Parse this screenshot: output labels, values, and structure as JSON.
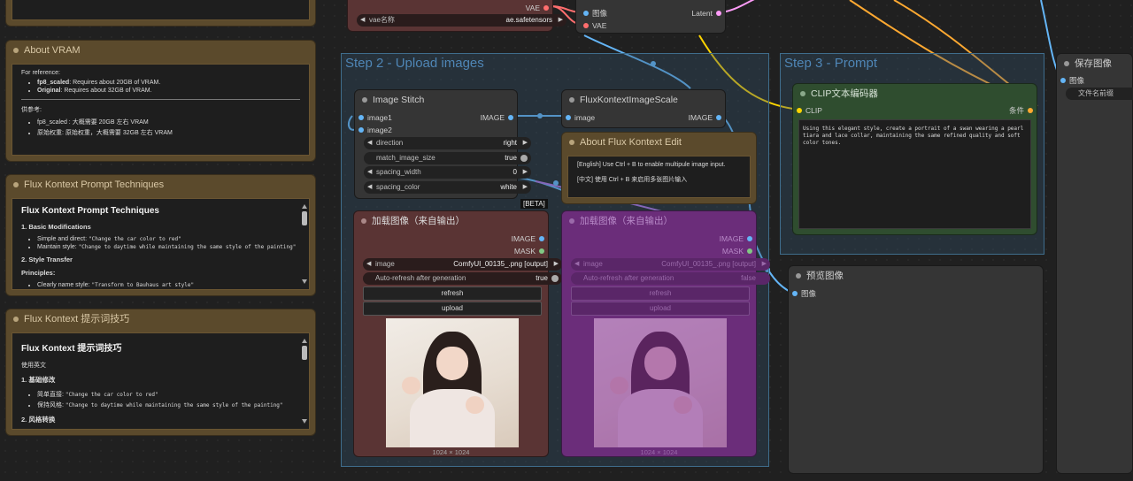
{
  "groups": {
    "step2": "Step 2 - Upload images",
    "step3": "Step 3 - Prompt"
  },
  "top_vae_node": {
    "vae_output": "VAE",
    "vae_name_label": "vae名称",
    "vae_name_value": "ae.safetensors"
  },
  "top_decode_node": {
    "image_input": "图像",
    "vae_input": "VAE",
    "latent_output": "Latent"
  },
  "about_vram": {
    "title": "About VRAM",
    "intro": "For reference:",
    "items_en": [
      "fp8_scaled: Requires about 20GB of VRAM.",
      "Original: Requires about 32GB of VRAM."
    ],
    "intro_zh": "供参考:",
    "items_zh": [
      "fp8_scaled : 大概需要 20GB 左右 VRAM",
      "原始权重: 原始权重，大概需要 32GB 左右 VRAM"
    ]
  },
  "prompt_tech_en": {
    "title": "Flux Kontext Prompt Techniques",
    "heading": "Flux Kontext Prompt Techniques",
    "section1": "1. Basic Modifications",
    "s1_items": [
      "Simple and direct: \"Change the car color to red\"",
      "Maintain style: \"Change to daytime while maintaining the same style of the painting\""
    ],
    "section2": "2. Style Transfer",
    "principles": "Principles:",
    "p_items": [
      "Clearly name style: \"Transform to Bauhaus art style\""
    ]
  },
  "prompt_tech_zh": {
    "title": "Flux Kontext 提示词技巧",
    "heading": "Flux Kontext 提示词技巧",
    "intro": "使用英文",
    "section1": "1. 基础修改",
    "s1_items": [
      "简单直接: \"Change the car color to red\"",
      "保持风格: \"Change to daytime while maintaining the same style of the painting\""
    ],
    "section2": "2. 风格转换"
  },
  "image_stitch": {
    "title": "Image Stitch",
    "input1": "image1",
    "input2": "image2",
    "output": "IMAGE",
    "direction_label": "direction",
    "direction_value": "right",
    "match_label": "match_image_size",
    "match_value": "true",
    "spacing_width_label": "spacing_width",
    "spacing_width_value": "0",
    "spacing_color_label": "spacing_color",
    "spacing_color_value": "white"
  },
  "scale_node": {
    "title": "FluxKontextImageScale",
    "input": "image",
    "output": "IMAGE"
  },
  "about_edit": {
    "title": "About Flux Kontext Edit",
    "line_en": "[English] Use Ctrl + B to enable multipule image input.",
    "line_zh": "[中文] 使用 Ctrl + B 来启用多张图片输入"
  },
  "beta_badge": "[BETA]",
  "load_image_1": {
    "title": "加载图像（来自输出）",
    "out_image": "IMAGE",
    "out_mask": "MASK",
    "image_label": "image",
    "image_value": "ComfyUI_00135_.png [output]",
    "refresh_label": "Auto-refresh after generation",
    "refresh_value": "true",
    "btn_refresh": "refresh",
    "btn_upload": "upload",
    "caption": "1024 × 1024"
  },
  "load_image_2": {
    "title": "加载图像（来自输出）",
    "out_image": "IMAGE",
    "out_mask": "MASK",
    "image_label": "image",
    "image_value": "ComfyUI_00135_.png [output]",
    "refresh_label": "Auto-refresh after generation",
    "refresh_value": "false",
    "btn_refresh": "refresh",
    "btn_upload": "upload",
    "caption": "1024 × 1024"
  },
  "clip_node": {
    "title": "CLIP文本编码器",
    "input": "CLIP",
    "output": "条件",
    "text": "Using this elegant style, create a portrait of a swan wearing a pearl tiara and lace collar, maintaining the same refined quality and soft color tones."
  },
  "preview_node": {
    "title": "预览图像",
    "input": "图像"
  },
  "save_node": {
    "title": "保存图像",
    "input": "图像",
    "prefix_label": "文件名前缀"
  },
  "colors": {
    "image_pin": "#64b5f6",
    "vae_pin": "#ff6e6e",
    "clip_pin": "#ffd500",
    "cond_pin": "#ffa931",
    "mask_pin": "#81c784",
    "latent_pin": "#ff9cf9"
  }
}
